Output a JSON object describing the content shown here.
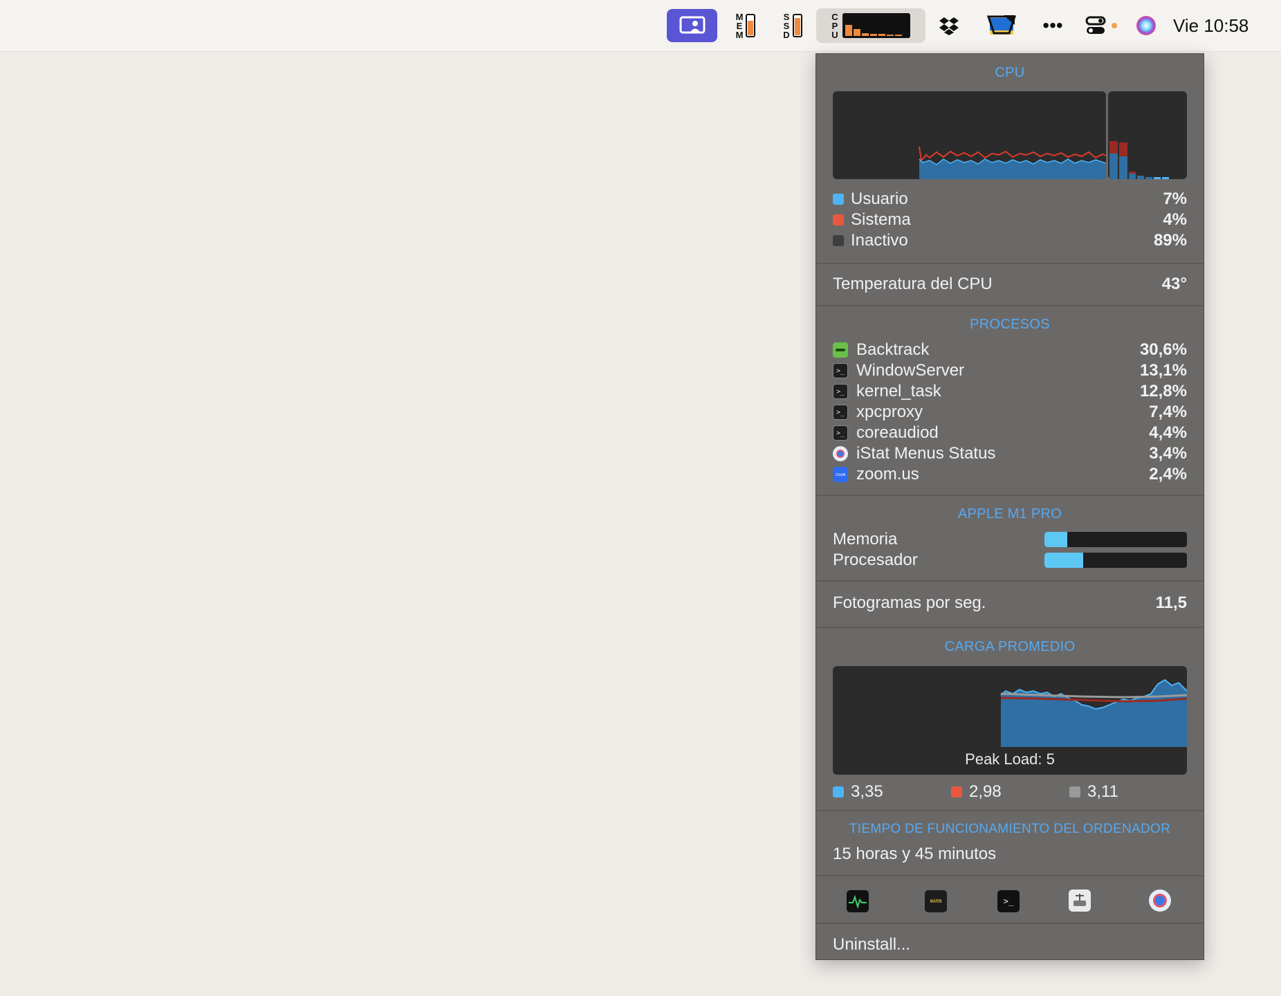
{
  "menubar": {
    "mem_label": "MEM",
    "ssd_label": "SSD",
    "cpu_label": "CPU",
    "mem_fill": 0.7,
    "ssd_fill": 0.85,
    "clock": "Vie 10:58",
    "icons": [
      "screen-share-icon",
      "dropbox-icon",
      "display-icon",
      "more-dots-icon",
      "control-center-icon",
      "siri-icon"
    ]
  },
  "panel": {
    "cpu": {
      "title": "CPU",
      "legend": [
        {
          "label": "Usuario",
          "value": "7%",
          "color": "#4fb3f6"
        },
        {
          "label": "Sistema",
          "value": "4%",
          "color": "#e9573f"
        },
        {
          "label": "Inactivo",
          "value": "89%",
          "color": "#3e3e3e"
        }
      ]
    },
    "temperature": {
      "label": "Temperatura del CPU",
      "value": "43°"
    },
    "processes": {
      "title": "PROCESOS",
      "items": [
        {
          "name": "Backtrack",
          "value": "30,6%",
          "icon": "backtrack-icon"
        },
        {
          "name": "WindowServer",
          "value": "13,1%",
          "icon": "terminal-icon"
        },
        {
          "name": "kernel_task",
          "value": "12,8%",
          "icon": "terminal-icon"
        },
        {
          "name": "xpcproxy",
          "value": "7,4%",
          "icon": "terminal-icon"
        },
        {
          "name": "coreaudiod",
          "value": "4,4%",
          "icon": "terminal-icon"
        },
        {
          "name": "iStat Menus Status",
          "value": "3,4%",
          "icon": "istat-icon"
        },
        {
          "name": "zoom.us",
          "value": "2,4%",
          "icon": "zoom-icon"
        }
      ]
    },
    "gpu": {
      "title": "APPLE M1 PRO",
      "memory_label": "Memoria",
      "memory_level": 0.16,
      "processor_label": "Procesador",
      "processor_level": 0.27
    },
    "fps": {
      "label": "Fotogramas por seg.",
      "value": "11,5"
    },
    "load": {
      "title": "CARGA PROMEDIO",
      "peak_label": "Peak Load: 5",
      "averages": [
        {
          "value": "3,35",
          "color": "#4fb3f6"
        },
        {
          "value": "2,98",
          "color": "#e9573f"
        },
        {
          "value": "3,11",
          "color": "#9a9a9a"
        }
      ]
    },
    "uptime": {
      "title": "TIEMPO DE FUNCIONAMIENTO DEL ORDENADOR",
      "value": "15 horas y 45 minutos"
    },
    "tools": [
      "activity-monitor-icon",
      "console-icon",
      "terminal-icon",
      "disk-utility-icon",
      "istat-icon"
    ],
    "uninstall_label": "Uninstall..."
  }
}
